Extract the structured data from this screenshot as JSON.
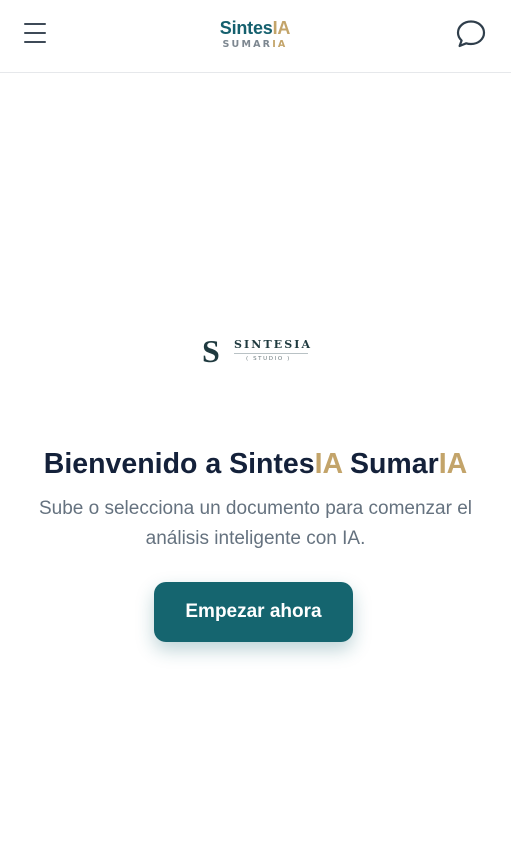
{
  "header": {
    "menu_icon": "hamburger-menu-icon",
    "brand": {
      "main_part1": "Sintes",
      "main_part2": "IA",
      "sub_part1": "SUMAR",
      "sub_part2": "IA"
    },
    "chat_icon": "chat-bubble-icon"
  },
  "logo": {
    "letter": "S",
    "word": "SINTESIA",
    "studio": "( STUDIO )"
  },
  "hero": {
    "title_part1": "Bienvenido a Sintes",
    "title_part2": "IA",
    "title_part3": " Sumar",
    "title_part4": "IA",
    "subtitle": "Sube o selecciona un documento para comenzar el análisis inteligente con IA.",
    "cta_label": "Empezar ahora"
  },
  "colors": {
    "brand_teal": "#15656f",
    "brand_gold": "#c3a46a",
    "title_text": "#14213a",
    "muted_text": "#65727f"
  }
}
